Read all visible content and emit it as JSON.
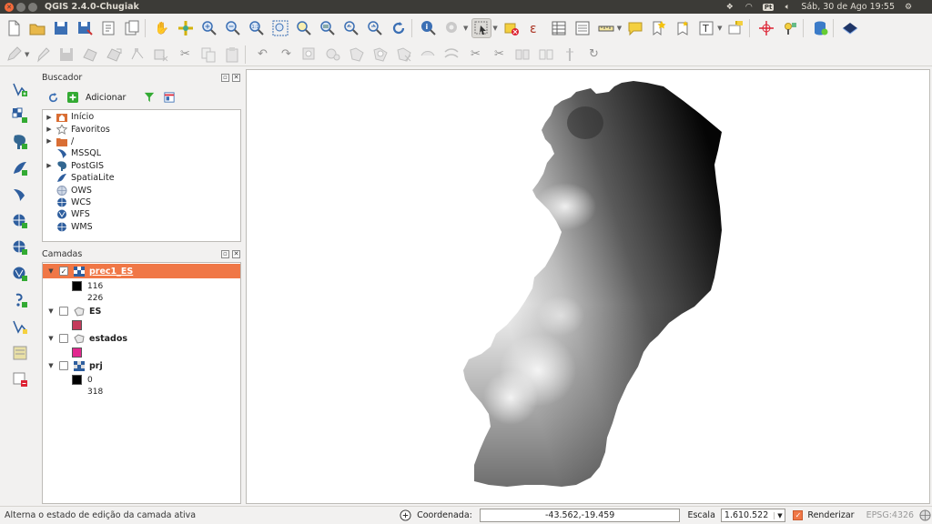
{
  "titlebar": {
    "app_title": "QGIS 2.4.0-Chugiak",
    "datetime": "Sáb, 30 de Ago 19:55",
    "keyboard_badge": "Pt"
  },
  "browser_panel": {
    "title": "Buscador",
    "add_label": "Adicionar",
    "items": [
      {
        "label": "Início",
        "icon": "home-folder-icon",
        "expandable": true
      },
      {
        "label": "Favoritos",
        "icon": "star-icon",
        "expandable": true
      },
      {
        "label": "/",
        "icon": "folder-icon",
        "expandable": true
      },
      {
        "label": "MSSQL",
        "icon": "mssql-icon",
        "expandable": false
      },
      {
        "label": "PostGIS",
        "icon": "postgis-icon",
        "expandable": true
      },
      {
        "label": "SpatiaLite",
        "icon": "spatialite-icon",
        "expandable": false
      },
      {
        "label": "OWS",
        "icon": "ows-globe-icon",
        "expandable": false
      },
      {
        "label": "WCS",
        "icon": "wcs-globe-icon",
        "expandable": false
      },
      {
        "label": "WFS",
        "icon": "wfs-globe-icon",
        "expandable": false
      },
      {
        "label": "WMS",
        "icon": "wms-globe-icon",
        "expandable": false
      }
    ]
  },
  "layers_panel": {
    "title": "Camadas",
    "layers": [
      {
        "name": "prec1_ES",
        "type": "raster",
        "checked": true,
        "selected": true,
        "legend": [
          {
            "swatch": "#000000",
            "value": "116"
          },
          {
            "swatch": null,
            "value": "226"
          }
        ]
      },
      {
        "name": "ES",
        "type": "polygon",
        "checked": false,
        "selected": false,
        "legend": [
          {
            "swatch": "#c43a5b",
            "value": ""
          }
        ]
      },
      {
        "name": "estados",
        "type": "polygon",
        "checked": false,
        "selected": false,
        "legend": [
          {
            "swatch": "#e2288f",
            "value": ""
          }
        ]
      },
      {
        "name": "prj",
        "type": "raster",
        "checked": false,
        "selected": false,
        "legend": [
          {
            "swatch": "#000000",
            "value": "0"
          },
          {
            "swatch": null,
            "value": "318"
          }
        ]
      }
    ]
  },
  "statusbar": {
    "message": "Alterna o estado de edição da camada ativa",
    "coord_label": "Coordenada:",
    "coord_value": "-43.562,-19.459",
    "scale_label": "Escala",
    "scale_value": "1.610.522",
    "render_label": "Renderizar",
    "crs_label": "EPSG:4326"
  },
  "colors": {
    "selection": "#f07746",
    "titlebar_bg": "#3c3b37",
    "window_bg": "#f2f1f0"
  }
}
